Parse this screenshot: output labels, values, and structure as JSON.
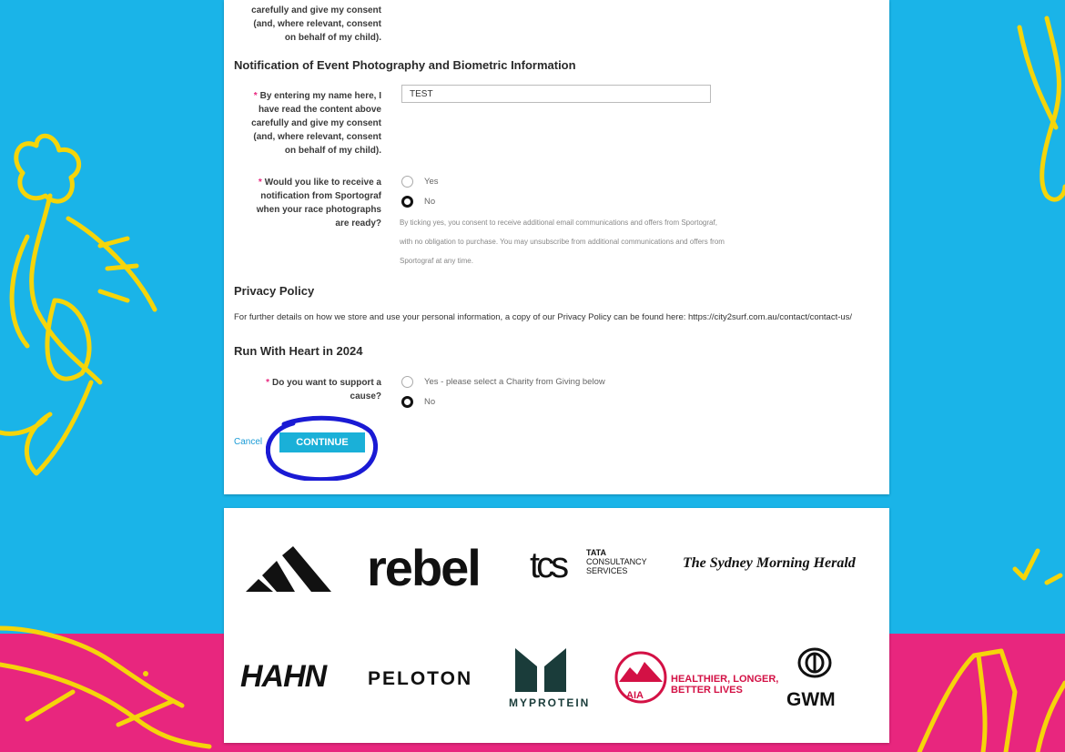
{
  "consent_fragment": {
    "lines": [
      "carefully and give my consent",
      "(and, where relevant, consent",
      "on behalf of my child)."
    ]
  },
  "photography_section": {
    "title": "Notification of Event Photography and Biometric Information",
    "name_label_lines": [
      "By entering my name here, I",
      "have read the content above",
      "carefully and give my consent",
      "(and, where relevant, consent",
      "on behalf of my child)."
    ],
    "name_value": "TEST",
    "notify_label_lines": [
      "Would you like to receive a",
      "notification from Sportograf",
      "when your race photographs",
      "are ready?"
    ],
    "option_yes": "Yes",
    "option_no": "No",
    "disclaimer": "By ticking yes, you consent to receive additional email communications and offers from Sportograf, with no obligation to purchase. You may unsubscribe from additional communications and offers from Sportograf at any time."
  },
  "privacy_section": {
    "title": "Privacy Policy",
    "text": "For further details on how we store and use your personal information, a copy of our Privacy Policy can be found here: https://city2surf.com.au/contact/contact-us/"
  },
  "charity_section": {
    "title": "Run With Heart in 2024",
    "label_lines": [
      "Do you want to support a",
      "cause?"
    ],
    "option_yes": "Yes - please select a Charity from Giving below",
    "option_no": "No"
  },
  "actions": {
    "cancel": "Cancel",
    "continue": "CONTINUE"
  },
  "sponsors": {
    "rebel": "rebel",
    "tcs_mark": "tcs",
    "tcs_top": "TATA",
    "tcs_mid": "CONSULTANCY",
    "tcs_bottom": "SERVICES",
    "smh": "The Sydney Morning Herald",
    "hahn": "HAHN",
    "peloton": "PELOTON",
    "myprotein": "MYPROTEIN",
    "aia_mark": "AIA",
    "aia_line1": "HEALTHIER, LONGER,",
    "aia_line2": "BETTER LIVES",
    "gwm": "GWM"
  },
  "colors": {
    "page_blue": "#1ab4e8",
    "band_pink": "#e8267e",
    "decor_yellow": "#f5d50a",
    "button": "#1ab0d8",
    "annotation_circle": "#1a1ad4",
    "aia_red": "#d31145"
  },
  "icons": {
    "adidas": "adidas-three-stripes-logo",
    "gwm": "gwm-shield-logo",
    "myprotein": "myprotein-m-logo",
    "aia": "aia-mountain-logo"
  }
}
